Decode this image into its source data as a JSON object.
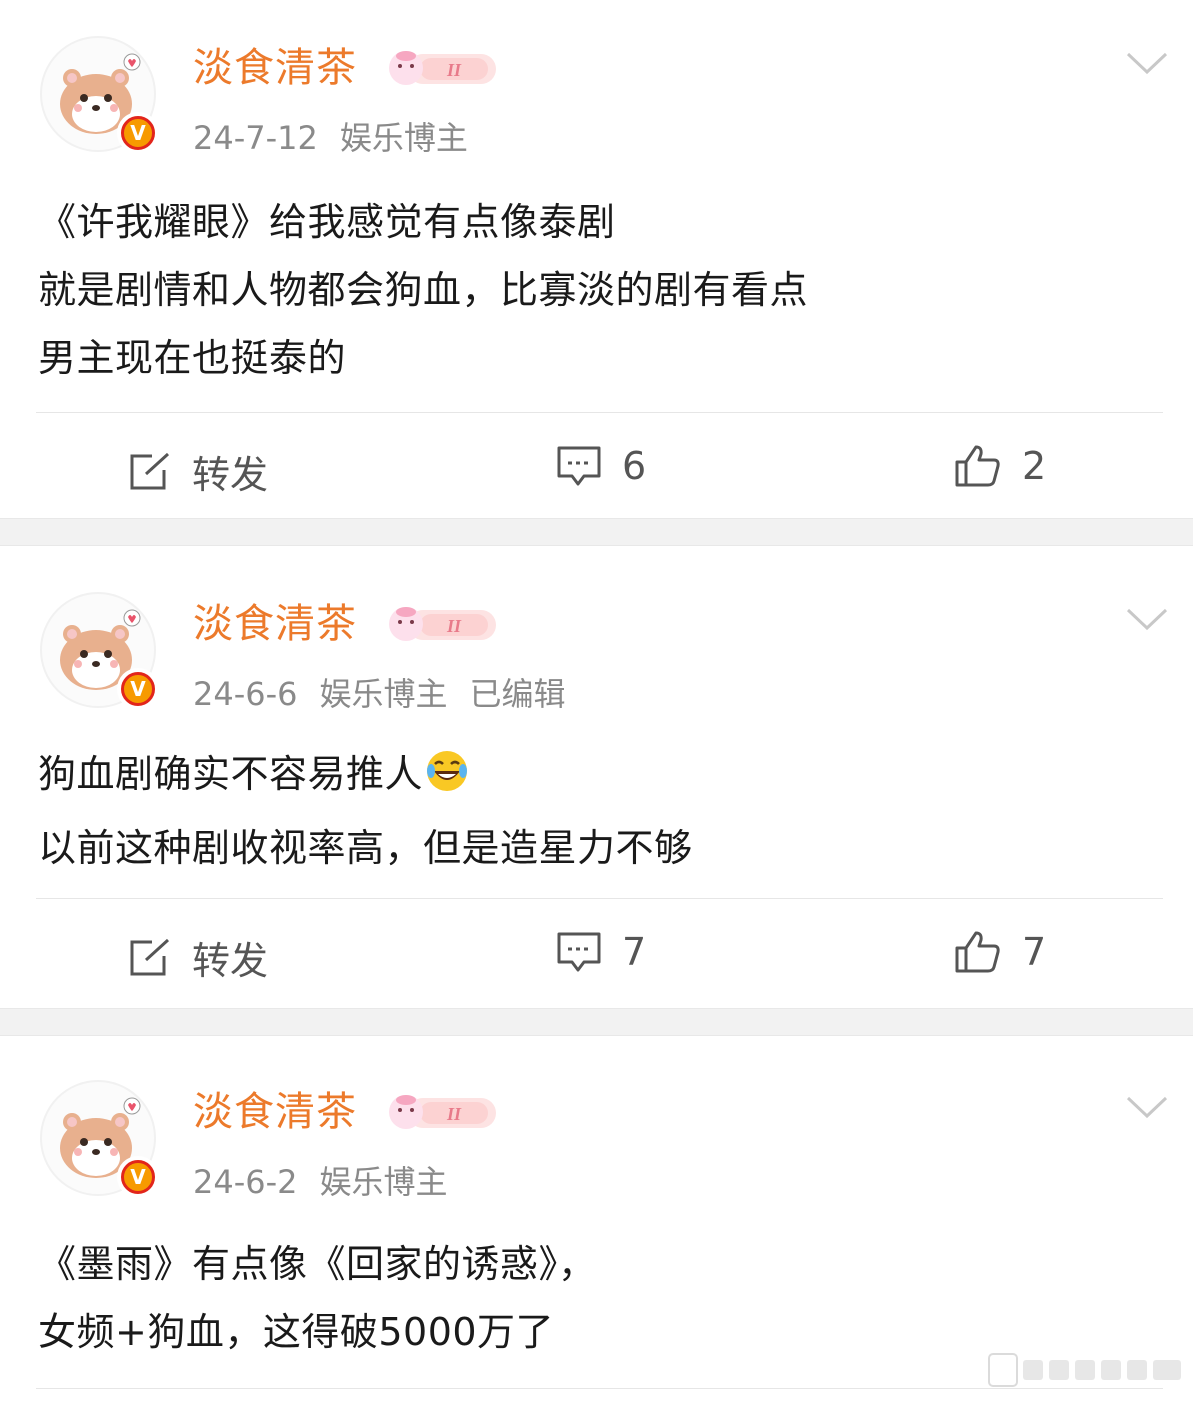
{
  "posts": [
    {
      "username": "淡食清茶",
      "level_badge": "II",
      "date": "24-7-12",
      "role": "娱乐博主",
      "edited": "",
      "lines": [
        "《许我耀眼》给我感觉有点像泰剧",
        "就是剧情和人物都会狗血，比寡淡的剧有看点",
        "男主现在也挺泰的"
      ],
      "repost_label": "转发",
      "comments": "6",
      "likes": "2"
    },
    {
      "username": "淡食清茶",
      "level_badge": "II",
      "date": "24-6-6",
      "role": "娱乐博主",
      "edited": "已编辑",
      "lines": [
        "狗血剧确实不容易推人",
        "以前这种剧收视率高，但是造星力不够"
      ],
      "emoji_after_line": 0,
      "emoji": "laugh-cry-emoji",
      "repost_label": "转发",
      "comments": "7",
      "likes": "7"
    },
    {
      "username": "淡食清茶",
      "level_badge": "II",
      "date": "24-6-2",
      "role": "娱乐博主",
      "edited": "",
      "lines": [
        "《墨雨》有点像《回家的诱惑》，",
        "女频+狗血，这得破5000万了"
      ]
    }
  ],
  "icons": {
    "verified": "verified-v-icon",
    "more": "chevron-down-icon",
    "repost": "share-icon",
    "comment": "comment-icon",
    "like": "thumbs-up-icon"
  },
  "colors": {
    "username": "#ec7a2b",
    "meta": "#8a8a8a",
    "verified": "#f79a00",
    "separator": "#f2f2f2"
  }
}
